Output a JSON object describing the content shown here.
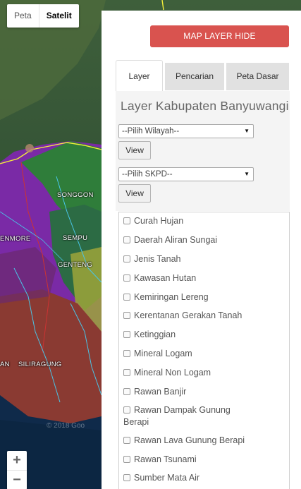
{
  "map": {
    "type_buttons": [
      {
        "label": "Peta"
      },
      {
        "label": "Satelit"
      }
    ],
    "place_labels": [
      "SONGGON",
      "SEMPU",
      "GENTENG",
      "ENMORE",
      "SILIRAGUNG",
      "AN"
    ],
    "zoom_in": "+",
    "zoom_out": "−",
    "copyright": "© 2018 Goo"
  },
  "panel": {
    "hide_button": "MAP LAYER HIDE",
    "tabs": [
      {
        "label": "Layer",
        "active": true
      },
      {
        "label": "Pencarian",
        "active": false
      },
      {
        "label": "Peta Dasar",
        "active": false
      }
    ],
    "layer_title": "Layer Kabupaten Banyuwangi",
    "wilayah_select": "--Pilih Wilayah--",
    "skpd_select": "--Pilih SKPD--",
    "view_label": "View",
    "layers": [
      "Curah Hujan",
      "Daerah Aliran Sungai",
      "Jenis Tanah",
      "Kawasan Hutan",
      "Kemiringan Lereng",
      "Kerentanan Gerakan Tanah",
      "Ketinggian",
      "Mineral Logam",
      "Mineral Non Logam",
      "Rawan Banjir",
      "Rawan Dampak Gunung Berapi",
      "Rawan Lava Gunung Berapi",
      "Rawan Tsunami",
      "Sumber Mata Air"
    ]
  },
  "colors": {
    "hide_button": "#d9534f",
    "tab_inactive": "#e1e1e1",
    "region_purple": "#7a2aa6",
    "region_green": "#2f7d3a",
    "region_red": "#8a3a32",
    "boundary_yellow": "#f4ef3a"
  }
}
